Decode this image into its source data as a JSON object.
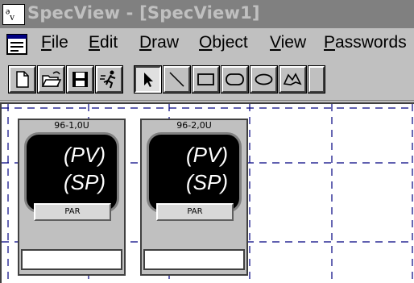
{
  "window": {
    "icon_glyph": "ᵊᵥ",
    "title": "SpecView - [SpecView1]"
  },
  "menu": {
    "items": [
      {
        "underline": "F",
        "rest": "ile",
        "key": "file"
      },
      {
        "underline": "E",
        "rest": "dit",
        "key": "edit"
      },
      {
        "underline": "D",
        "rest": "raw",
        "key": "draw"
      },
      {
        "underline": "O",
        "rest": "bject",
        "key": "object"
      },
      {
        "underline": "V",
        "rest": "iew",
        "key": "view"
      },
      {
        "underline": "P",
        "rest": "asswords",
        "key": "passwords"
      }
    ]
  },
  "toolbar": {
    "buttons": [
      "new-file-icon",
      "open-folder-icon",
      "save-disk-icon",
      "run-mode-icon",
      "pointer-arrow-icon",
      "line-tool-icon",
      "rectangle-tool-icon",
      "rounded-rect-tool-icon",
      "ellipse-tool-icon",
      "polyline-tool-icon"
    ],
    "selected": "pointer-arrow-icon"
  },
  "faceplates": [
    {
      "tag": "96-1,0U",
      "pv": "(PV)",
      "sp": "(SP)",
      "par": "PAR"
    },
    {
      "tag": "96-2,0U",
      "pv": "(PV)",
      "sp": "(SP)",
      "par": "PAR"
    }
  ],
  "colors": {
    "title_bar": "#808080",
    "grid_line": "#000080",
    "display_bg": "#000000"
  }
}
